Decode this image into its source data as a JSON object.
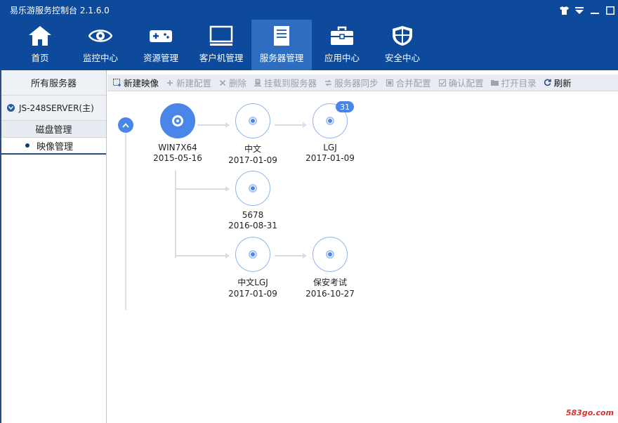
{
  "app": {
    "title": "易乐游服务控制台 2.1.6.0"
  },
  "window_controls": [
    {
      "icon": "shirt-icon"
    },
    {
      "icon": "dropdown-icon"
    },
    {
      "icon": "minimize-icon"
    },
    {
      "icon": "maximize-icon"
    }
  ],
  "nav": {
    "items": [
      {
        "label": "首页",
        "icon": "home-icon"
      },
      {
        "label": "监控中心",
        "icon": "eye-icon"
      },
      {
        "label": "资源管理",
        "icon": "gamepad-icon"
      },
      {
        "label": "客户机管理",
        "icon": "monitor-icon"
      },
      {
        "label": "服务器管理",
        "icon": "server-icon",
        "active": true
      },
      {
        "label": "应用中心",
        "icon": "toolbox-icon"
      },
      {
        "label": "安全中心",
        "icon": "shield-icon"
      }
    ]
  },
  "sidebar": {
    "all_servers": "所有服务器",
    "server_name": "JS-248SERVER(主)",
    "group_label": "磁盘管理",
    "sub_item": "映像管理"
  },
  "toolbar": {
    "buttons": [
      {
        "label": "新建映像",
        "icon": "new-image-icon",
        "enabled": true
      },
      {
        "label": "新建配置",
        "icon": "plus-icon",
        "enabled": false
      },
      {
        "label": "删除",
        "icon": "delete-icon",
        "enabled": false
      },
      {
        "label": "挂载到服务器",
        "icon": "mount-icon",
        "enabled": false
      },
      {
        "label": "服务器同步",
        "icon": "sync-icon",
        "enabled": false
      },
      {
        "label": "合并配置",
        "icon": "merge-icon",
        "enabled": false
      },
      {
        "label": "确认配置",
        "icon": "confirm-icon",
        "enabled": false
      },
      {
        "label": "打开目录",
        "icon": "folder-icon",
        "enabled": false
      },
      {
        "label": "刷新",
        "icon": "refresh-icon",
        "enabled": true
      }
    ]
  },
  "tree": {
    "root": {
      "name": "WIN7X64",
      "date": "2015-05-16"
    },
    "nodes": [
      {
        "name": "中文",
        "date": "2017-01-09"
      },
      {
        "name": "LGJ",
        "date": "2017-01-09",
        "badge": "31"
      },
      {
        "name": "5678",
        "date": "2016-08-31"
      },
      {
        "name": "中文LGJ",
        "date": "2017-01-09"
      },
      {
        "name": "保安考试",
        "date": "2016-10-27"
      }
    ]
  },
  "watermark": "583go.com",
  "colors": {
    "header": "#0d4a9b",
    "nav_active": "#2e6dc0",
    "accent": "#4a86e8"
  }
}
